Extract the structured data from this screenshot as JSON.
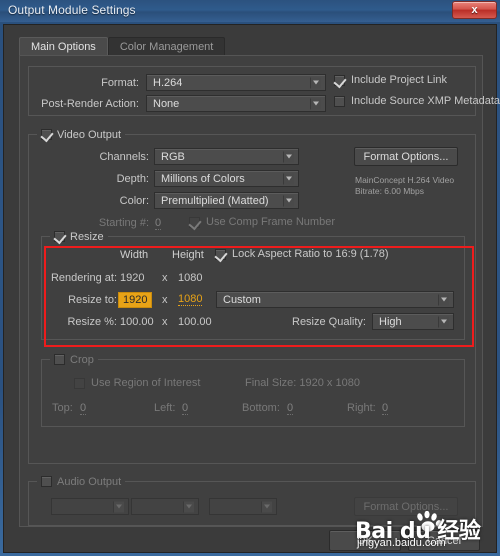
{
  "window": {
    "title": "Output Module Settings",
    "close_label": "x"
  },
  "tabs": [
    {
      "label": "Main Options",
      "active": true
    },
    {
      "label": "Color Management",
      "active": false
    }
  ],
  "top_section": {
    "format_label": "Format:",
    "format_value": "H.264",
    "post_render_label": "Post-Render Action:",
    "post_render_value": "None",
    "include_project_link_label": "Include Project Link",
    "include_project_link_checked": true,
    "include_xmp_label": "Include Source XMP Metadata",
    "include_xmp_checked": false
  },
  "video_output": {
    "legend": "Video Output",
    "legend_checked": true,
    "channels_label": "Channels:",
    "channels_value": "RGB",
    "depth_label": "Depth:",
    "depth_value": "Millions of Colors",
    "color_label": "Color:",
    "color_value": "Premultiplied (Matted)",
    "starting_label": "Starting #:",
    "starting_value": "0",
    "use_comp_frame_label": "Use Comp Frame Number",
    "use_comp_frame_checked": true,
    "format_options_button": "Format Options...",
    "codec_line1": "MainConcept H.264 Video",
    "codec_line2": "Bitrate: 6.00 Mbps"
  },
  "resize": {
    "legend": "Resize",
    "legend_checked": true,
    "col_width": "Width",
    "col_height": "Height",
    "lock_aspect_label": "Lock Aspect Ratio to  16:9 (1.78)",
    "lock_aspect_checked": true,
    "rendering_at_label": "Rendering at:",
    "rendering_width": "1920",
    "rendering_height": "1080",
    "resize_to_label": "Resize to:",
    "resize_to_width": "1920",
    "resize_to_height": "1080",
    "resize_pct_label": "Resize %:",
    "resize_pct_width": "100.00",
    "resize_pct_height": "100.00",
    "times": "x",
    "preset_value": "Custom",
    "quality_label": "Resize Quality:",
    "quality_value": "High"
  },
  "crop": {
    "legend": "Crop",
    "legend_checked": false,
    "use_roi_label": "Use Region of Interest",
    "use_roi_checked": false,
    "final_size_label": "Final Size: 1920 x 1080",
    "top_label": "Top:",
    "top_value": "0",
    "left_label": "Left:",
    "left_value": "0",
    "bottom_label": "Bottom:",
    "bottom_value": "0",
    "right_label": "Right:",
    "right_value": "0"
  },
  "audio_output": {
    "legend": "Audio Output",
    "legend_checked": false,
    "rate_value": "",
    "depth_value": "",
    "channels_value": "",
    "format_options_button": "Format Options..."
  },
  "footer": {
    "ok_label": "OK",
    "cancel_label": "Cancel"
  },
  "watermark": {
    "main": "Bai    du 经验",
    "url": "jingyan.baidu.com"
  },
  "colors": {
    "accent_orange": "#e8a317",
    "annotation_red": "#ee1c1c",
    "panel_bg": "#404040",
    "titlebar_blue": "#2d5585"
  }
}
